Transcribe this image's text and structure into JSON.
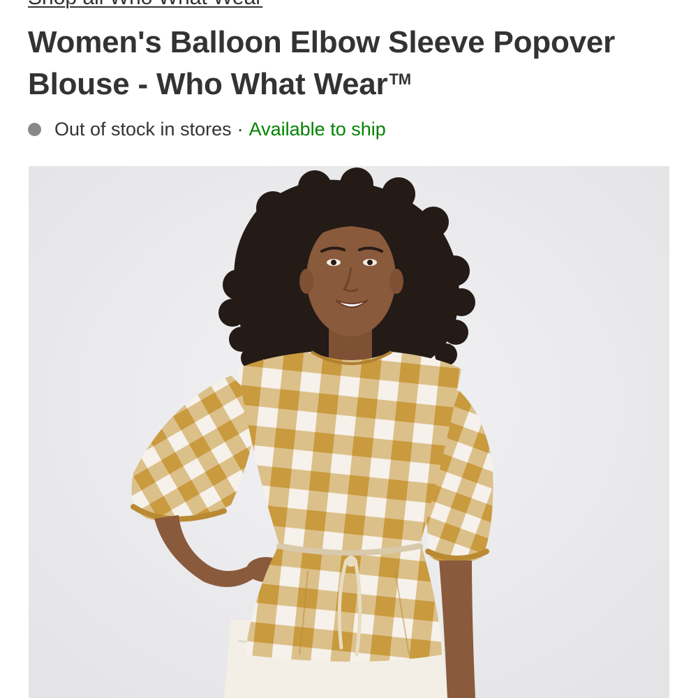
{
  "product": {
    "brand_link": "Shop all Who What Wear",
    "title": "Women's Balloon Elbow Sleeve Popover Blouse - Who What Wear",
    "trademark": "TM"
  },
  "availability": {
    "store_status": "Out of stock in stores",
    "separator": "·",
    "ship_status": "Available to ship",
    "colors": {
      "dot": "#888888",
      "ship": "#008300"
    }
  },
  "image": {
    "subject": "model wearing mustard and white gingham puff-sleeve blouse with drawstring waist and cream skirt",
    "colors": {
      "background": "#e9e9eb",
      "gingham_dark": "#c99a3e",
      "gingham_mid": "#dcc08a",
      "gingham_light": "#f6f1ea",
      "skin": "#8a5a3c",
      "hair": "#241a16",
      "skirt": "#f3efe6"
    }
  }
}
